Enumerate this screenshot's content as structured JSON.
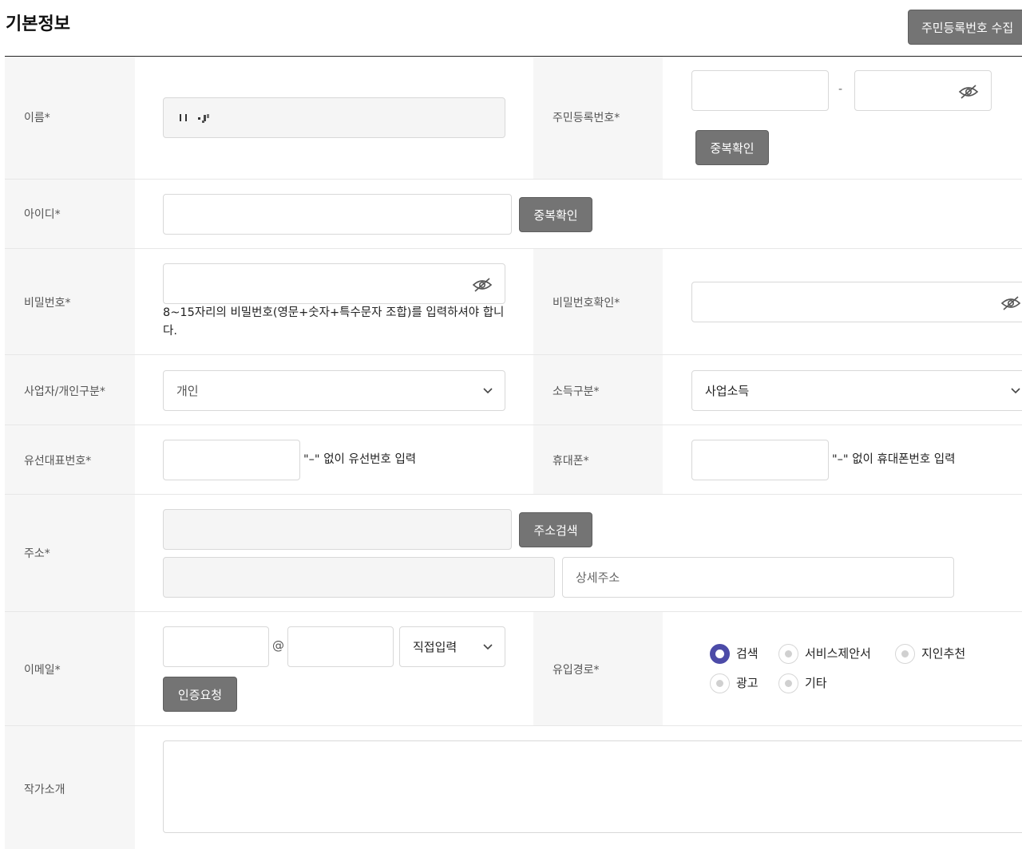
{
  "header": {
    "title": "기본정보",
    "rrn_collect_button": "주민등록번호 수집"
  },
  "labels": {
    "name": "이름*",
    "rrn": "주민등록번호*",
    "userid": "아이디*",
    "password": "비밀번호*",
    "password_confirm": "비밀번호확인*",
    "biz_type": "사업자/개인구분*",
    "income_type": "소득구분*",
    "landline": "유선대표번호*",
    "mobile": "휴대폰*",
    "address": "주소*",
    "email": "이메일*",
    "referral": "유입경로*",
    "intro": "작가소개"
  },
  "buttons": {
    "rrn_dup_check": "중복확인",
    "id_dup_check": "중복확인",
    "address_search": "주소검색",
    "email_verify": "인증요청"
  },
  "fields": {
    "name_value": "",
    "rrn_separator": "-",
    "password_help": "8~15자리의 비밀번호(영문+숫자+특수문자 조합)를 입력하셔야 합니다.",
    "biz_type_value": "개인",
    "income_type_value": "사업소득",
    "landline_help": "\"–\" 없이 유선번호 입력",
    "mobile_help": "\"–\" 없이 휴대폰번호 입력",
    "address_detail_placeholder": "상세주소",
    "email_at": "@",
    "email_domain_select": "직접입력"
  },
  "referral_options": [
    {
      "label": "검색",
      "selected": true
    },
    {
      "label": "서비스제안서",
      "selected": false
    },
    {
      "label": "지인추천",
      "selected": false
    },
    {
      "label": "광고",
      "selected": false
    },
    {
      "label": "기타",
      "selected": false
    }
  ],
  "colors": {
    "button_gray": "#747474",
    "radio_selected": "#4c4ba8",
    "label_bg": "#f6f6f6"
  }
}
